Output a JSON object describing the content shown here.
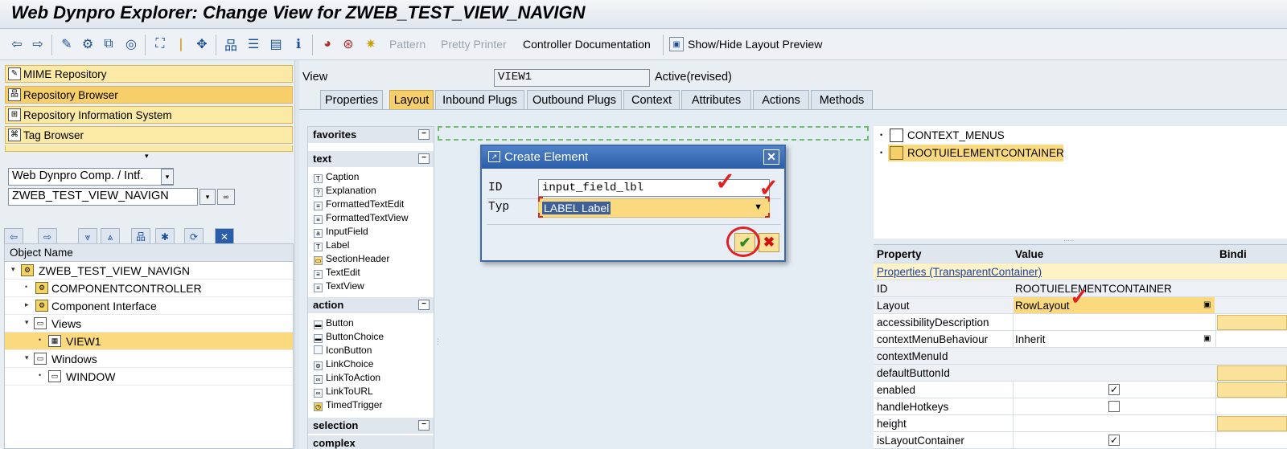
{
  "window": {
    "title": "Web Dynpro Explorer: Change View for ZWEB_TEST_VIEW_NAVIGN"
  },
  "toolbar": {
    "icons": [
      "back-icon",
      "forward-icon",
      "edit-icon",
      "display-change-icon",
      "activate-icon",
      "where-used-icon",
      "object-list-icon",
      "navigator-icon",
      "display-object-list-icon",
      "hierarchy-icon",
      "stack-icon",
      "info-icon",
      "test-icon",
      "web-icon",
      "wand-icon"
    ],
    "pattern": "Pattern",
    "pretty_printer": "Pretty Printer",
    "controller_doc": "Controller Documentation",
    "layout_preview": "Show/Hide Layout Preview"
  },
  "nav": {
    "buttons": [
      "MIME Repository",
      "Repository Browser",
      "Repository Information System",
      "Tag Browser"
    ],
    "selector_type": "Web Dynpro Comp. / Intf.",
    "selector_name": "ZWEB_TEST_VIEW_NAVIGN",
    "tree_header": "Object Name",
    "tree": [
      {
        "label": "ZWEB_TEST_VIEW_NAVIGN",
        "level": 0,
        "toggle": "▾"
      },
      {
        "label": "COMPONENTCONTROLLER",
        "level": 1,
        "toggle": "•"
      },
      {
        "label": "Component Interface",
        "level": 1,
        "toggle": "▸"
      },
      {
        "label": "Views",
        "level": 1,
        "toggle": "▾"
      },
      {
        "label": "VIEW1",
        "level": 2,
        "toggle": "•"
      },
      {
        "label": "Windows",
        "level": 1,
        "toggle": "▾"
      },
      {
        "label": "WINDOW",
        "level": 2,
        "toggle": "•"
      }
    ]
  },
  "view": {
    "label": "View",
    "name": "VIEW1",
    "status": "Active(revised)",
    "tabs": [
      "Properties",
      "Layout",
      "Inbound Plugs",
      "Outbound Plugs",
      "Context",
      "Attributes",
      "Actions",
      "Methods"
    ],
    "active_tab": "Layout"
  },
  "palette": {
    "favorites": "favorites",
    "text": "text",
    "text_items": [
      "Caption",
      "Explanation",
      "FormattedTextEdit",
      "FormattedTextView",
      "InputField",
      "Label",
      "SectionHeader",
      "TextEdit",
      "TextView"
    ],
    "action": "action",
    "action_items": [
      "Button",
      "ButtonChoice",
      "IconButton",
      "LinkChoice",
      "LinkToAction",
      "LinkToURL",
      "TimedTrigger"
    ],
    "selection": "selection",
    "complex": "complex"
  },
  "ui_tree": {
    "items": [
      "CONTEXT_MENUS",
      "ROOTUIELEMENTCONTAINER"
    ]
  },
  "properties": {
    "headers": [
      "Property",
      "Value",
      "Bindi"
    ],
    "group": "Properties (TransparentContainer)",
    "rows": [
      {
        "name": "ID",
        "value": "ROOTUIELEMENTCONTAINER"
      },
      {
        "name": "Layout",
        "value": "RowLayout"
      },
      {
        "name": "accessibilityDescription",
        "value": ""
      },
      {
        "name": "contextMenuBehaviour",
        "value": "Inherit"
      },
      {
        "name": "contextMenuId",
        "value": ""
      },
      {
        "name": "defaultButtonId",
        "value": ""
      },
      {
        "name": "enabled",
        "value": ""
      },
      {
        "name": "handleHotkeys",
        "value": ""
      },
      {
        "name": "height",
        "value": ""
      },
      {
        "name": "isLayoutContainer",
        "value": ""
      }
    ]
  },
  "dialog": {
    "title": "Create Element",
    "id_label": "ID",
    "id_value": "input_field_lbl",
    "type_label": "Typ",
    "type_value": "LABEL Label"
  },
  "colors": {
    "accent": "#f7cf6a",
    "dialog_title": "#2b5ea8",
    "annotation": "#e02020"
  }
}
